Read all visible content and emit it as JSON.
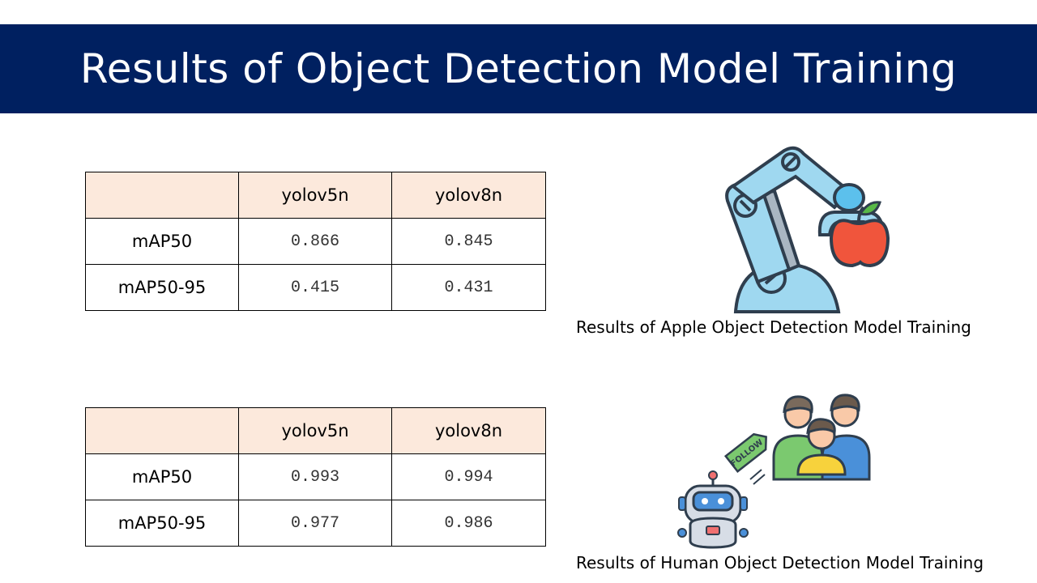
{
  "title": "Results of Object Detection Model Training",
  "tables": [
    {
      "headers": [
        "",
        "yolov5n",
        "yolov8n"
      ],
      "rows": [
        {
          "metric": "mAP50",
          "yolov5n": "0.866",
          "yolov8n": "0.845"
        },
        {
          "metric": "mAP50-95",
          "yolov5n": "0.415",
          "yolov8n": "0.431"
        }
      ]
    },
    {
      "headers": [
        "",
        "yolov5n",
        "yolov8n"
      ],
      "rows": [
        {
          "metric": "mAP50",
          "yolov5n": "0.993",
          "yolov8n": "0.994"
        },
        {
          "metric": "mAP50-95",
          "yolov5n": "0.977",
          "yolov8n": "0.986"
        }
      ]
    }
  ],
  "captions": {
    "apple": "Results of Apple Object Detection Model Training",
    "human": "Results of Human Object Detection Model Training"
  },
  "follow_tag": "FOLLOW",
  "icons": {
    "apple": "robot-arm-apple-icon",
    "human": "robot-following-people-icon"
  },
  "colors": {
    "title_bg": "#002060",
    "header_bg": "#fce9dc"
  }
}
